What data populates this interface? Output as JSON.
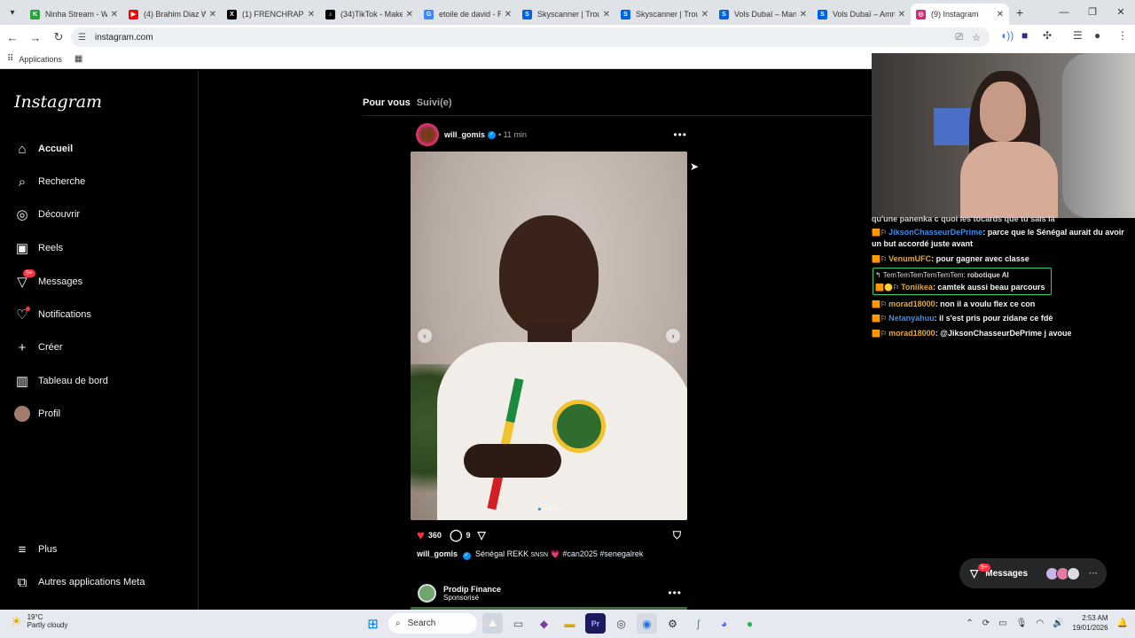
{
  "browser": {
    "tabs": [
      {
        "title": "Ninha Stream - W",
        "fav_color": "#2ea043",
        "fav_icon": "twitch-green-icon",
        "glyph": "K"
      },
      {
        "title": "(4) Brahim Diaz W",
        "fav_color": "#ff0000",
        "fav_icon": "youtube-icon",
        "glyph": "▶"
      },
      {
        "title": "(1) FRENCHRAPU",
        "fav_color": "#000000",
        "fav_icon": "x-icon",
        "glyph": "X"
      },
      {
        "title": "(34)TikTok - Make",
        "fav_color": "#000000",
        "fav_icon": "tiktok-icon",
        "glyph": "♪"
      },
      {
        "title": "etoile de david - R",
        "fav_color": "#4285f4",
        "fav_icon": "google-icon",
        "glyph": "G"
      },
      {
        "title": "Skyscanner | Trou",
        "fav_color": "#0062e3",
        "fav_icon": "skyscanner-icon",
        "glyph": "S"
      },
      {
        "title": "Skyscanner | Trou",
        "fav_color": "#0062e3",
        "fav_icon": "skyscanner-icon",
        "glyph": "S"
      },
      {
        "title": "Vols Dubaï – Man",
        "fav_color": "#0062e3",
        "fav_icon": "skyscanner-icon",
        "glyph": "S"
      },
      {
        "title": "Vols Dubaï – Amm",
        "fav_color": "#0062e3",
        "fav_icon": "skyscanner-icon",
        "glyph": "S"
      },
      {
        "title": "(9) Instagram",
        "fav_color": "#d62976",
        "fav_icon": "instagram-icon",
        "glyph": "◎",
        "active": true
      }
    ],
    "url": "instagram.com",
    "bookmarks_label": "Applications"
  },
  "instagram": {
    "logo": "Instagram",
    "nav": [
      {
        "label": "Accueil",
        "icon": "home-icon",
        "bold": true
      },
      {
        "label": "Recherche",
        "icon": "search-icon"
      },
      {
        "label": "Découvrir",
        "icon": "compass-icon"
      },
      {
        "label": "Reels",
        "icon": "reels-icon"
      },
      {
        "label": "Messages",
        "icon": "messenger-icon",
        "badge": "9+"
      },
      {
        "label": "Notifications",
        "icon": "heart-icon",
        "dot": true
      },
      {
        "label": "Créer",
        "icon": "plus-icon"
      },
      {
        "label": "Tableau de bord",
        "icon": "dashboard-icon"
      },
      {
        "label": "Profil",
        "icon": "avatar-icon"
      }
    ],
    "nav_bottom": [
      {
        "label": "Plus",
        "icon": "menu-icon"
      },
      {
        "label": "Autres applications Meta",
        "icon": "meta-apps-icon"
      }
    ],
    "feed_tabs": {
      "for_you": "Pour vous",
      "following": "Suivi(e)"
    },
    "post": {
      "username": "will_gomis",
      "time": "11 min",
      "likes": "360",
      "comments": "9",
      "caption_user": "will_gomis",
      "caption_text": "Sénégal REKK",
      "caption_small": "SNSN",
      "caption_heart": "💗",
      "hashtags": "#can2025 #senegalrek"
    },
    "next_post": {
      "username": "Prodip Finance",
      "subtitle": "Sponsorisé"
    },
    "messages_bubble": {
      "label": "Messages",
      "badge": "9+"
    }
  },
  "chat": {
    "lines": [
      {
        "user": "",
        "text": "qu'une panenka c quoi les tocards que tu sais là",
        "partial": true
      },
      {
        "user": "JiksonChasseurDePrime",
        "text": ": parce que le Sénégal aurait du avoir un but accordé juste avant",
        "user_color": "#3f8ce6"
      },
      {
        "user": "VenumUFC",
        "text": ": pour gagner avec classe",
        "user_color": "#e0aa3e"
      },
      {
        "reply_to": "TemTemTemTemTemTem:",
        "reply_text": "robotique AI",
        "user": "Toniikea",
        "text": ": camtek aussi beau parcours",
        "user_color": "#e0aa3e"
      },
      {
        "user": "morad18000",
        "text": ": non il a voulu flex ce con",
        "user_color": "#e0aa3e"
      },
      {
        "user": "Netanyahuu",
        "text": ": il s'est pris pour zidane ce fdè",
        "user_color": "#3f8ce6"
      },
      {
        "user": "morad18000",
        "text": ": @JiksonChasseurDePrime j avoue",
        "user_color": "#e0aa3e"
      }
    ]
  },
  "taskbar": {
    "temperature": "19°C",
    "weather": "Partly cloudy",
    "search": "Search",
    "time": "2:53 AM",
    "date": "19/01/2026"
  }
}
